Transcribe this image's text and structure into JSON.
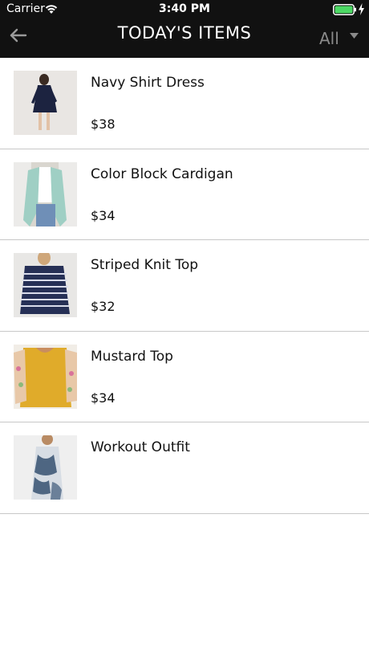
{
  "status_bar": {
    "carrier": "Carrier",
    "time": "3:40 PM"
  },
  "nav": {
    "title": "TODAY'S ITEMS",
    "filter_value": "All",
    "back_icon": "arrow-left-icon",
    "filter_icon": "chevron-down-icon"
  },
  "colors": {
    "bar_background": "#111111",
    "battery_green": "#4cd964",
    "filter_gray": "#8a8a8a",
    "divider": "#c8c8c8"
  },
  "items": [
    {
      "name": "Navy Shirt Dress",
      "price": "$38"
    },
    {
      "name": "Color Block Cardigan",
      "price": "$34"
    },
    {
      "name": "Striped Knit Top",
      "price": "$32"
    },
    {
      "name": "Mustard Top",
      "price": "$34"
    },
    {
      "name": "Workout Outfit",
      "price": ""
    }
  ]
}
